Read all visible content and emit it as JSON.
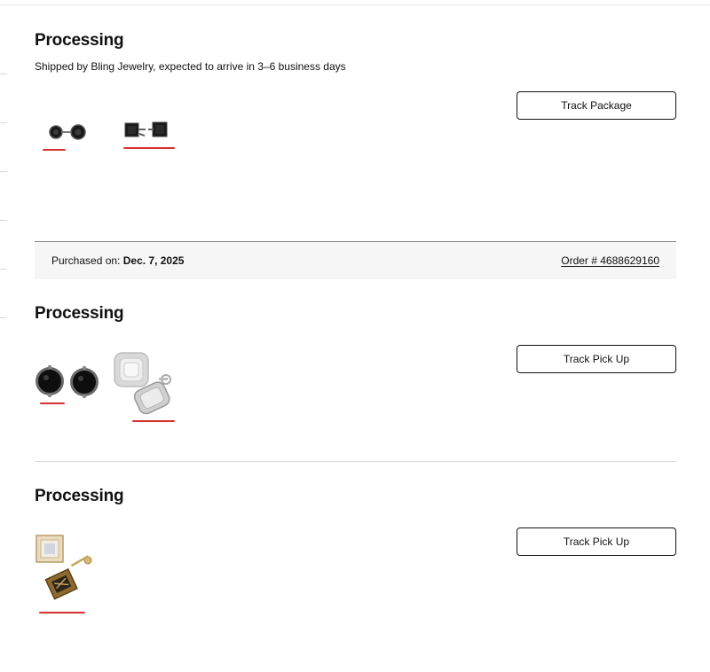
{
  "orders": [
    {
      "status": "Processing",
      "shipping_note": "Shipped by Bling Jewelry, expected to arrive in 3–6 business days",
      "action_label": "Track Package",
      "items": [
        {
          "icon": "black-round-stud-earrings"
        },
        {
          "icon": "black-square-stud-earrings"
        }
      ]
    },
    {
      "status": "Processing",
      "action_label": "Track Pick Up",
      "items": [
        {
          "icon": "black-round-stud-earrings"
        },
        {
          "icon": "silver-cushion-halo-earrings"
        }
      ]
    },
    {
      "status": "Processing",
      "action_label": "Track Pick Up",
      "items": [
        {
          "icon": "gold-square-halo-earrings"
        }
      ]
    }
  ],
  "order_bar": {
    "purchased_label": "Purchased on:",
    "purchased_date": "Dec. 7, 2025",
    "order_number": "Order # 4688629160"
  },
  "colors": {
    "annotation_underline": "#d63030",
    "order_bar_bg": "#f6f6f6",
    "button_border": "#111111"
  }
}
